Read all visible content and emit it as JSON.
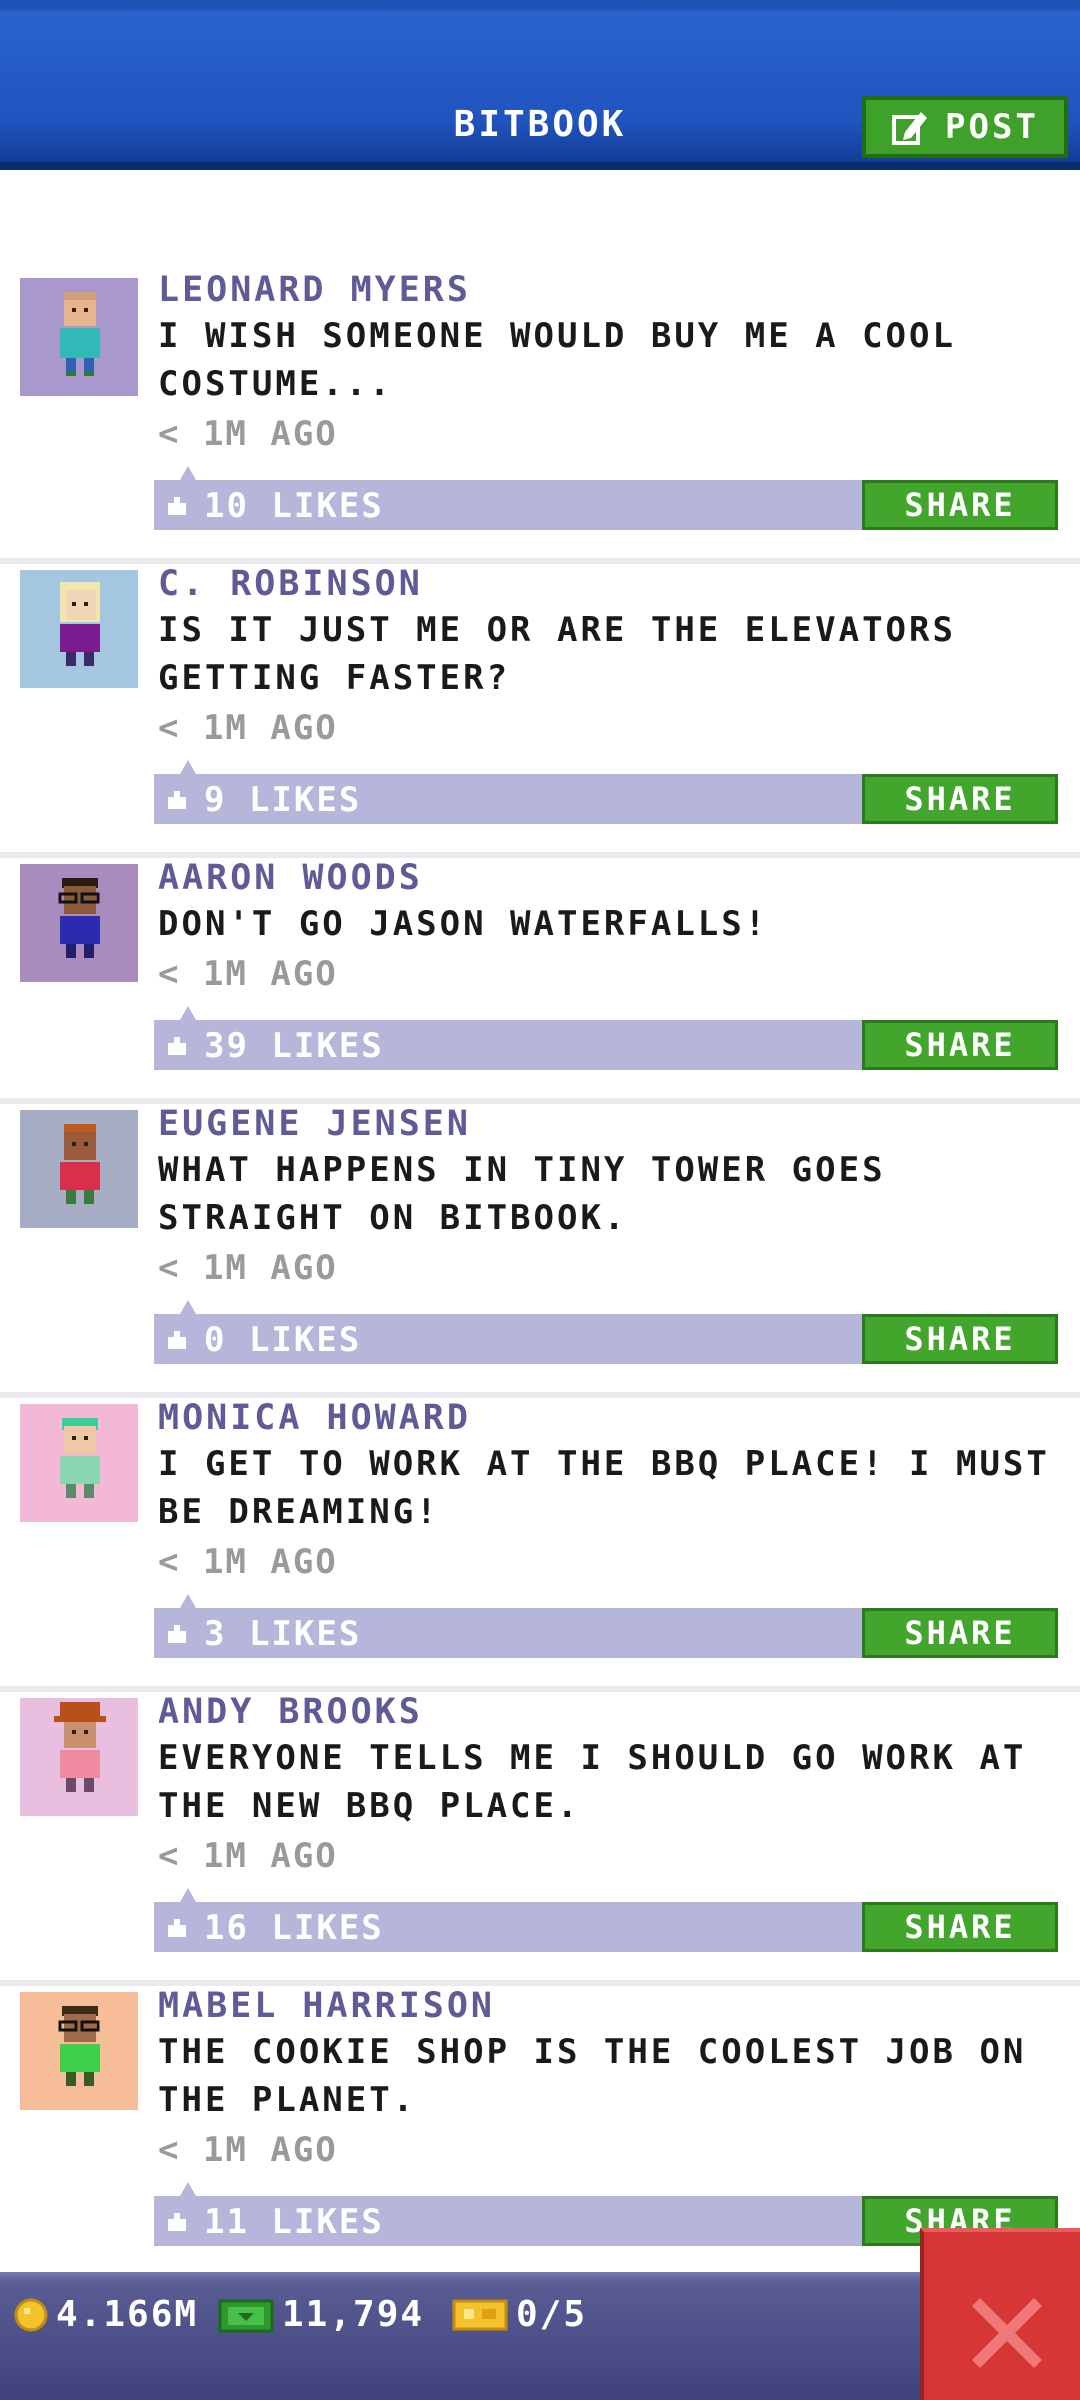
{
  "header": {
    "title": "BITBOOK",
    "post_label": "POST"
  },
  "posts": [
    {
      "name": "LEONARD MYERS",
      "message": "I WISH SOMEONE WOULD BUY ME A COOL COSTUME...",
      "time": "< 1M AGO",
      "likes": "10 LIKES",
      "share": "SHARE",
      "avatar_bg": "#a898cc"
    },
    {
      "name": "C. ROBINSON",
      "message": "IS IT JUST ME OR ARE THE ELEVATORS GETTING FASTER?",
      "time": "< 1M AGO",
      "likes": "9 LIKES",
      "share": "SHARE",
      "avatar_bg": "#a4c6df"
    },
    {
      "name": "AARON WOODS",
      "message": "DON'T GO JASON WATERFALLS!",
      "time": "< 1M AGO",
      "likes": "39 LIKES",
      "share": "SHARE",
      "avatar_bg": "#a98cbe"
    },
    {
      "name": "EUGENE JENSEN",
      "message": "WHAT HAPPENS IN TINY TOWER GOES STRAIGHT ON BITBOOK.",
      "time": "< 1M AGO",
      "likes": "0 LIKES",
      "share": "SHARE",
      "avatar_bg": "#a6adc4"
    },
    {
      "name": "MONICA HOWARD",
      "message": "I GET TO WORK AT THE BBQ PLACE! I MUST BE DREAMING!",
      "time": "< 1M AGO",
      "likes": "3 LIKES",
      "share": "SHARE",
      "avatar_bg": "#f2b8d6"
    },
    {
      "name": "ANDY BROOKS",
      "message": "EVERYONE TELLS ME I SHOULD GO WORK AT THE NEW BBQ PLACE.",
      "time": "< 1M AGO",
      "likes": "16 LIKES",
      "share": "SHARE",
      "avatar_bg": "#e8bfdf"
    },
    {
      "name": "MABEL HARRISON",
      "message": "THE COOKIE SHOP IS THE COOLEST JOB ON THE PLANET.",
      "time": "< 1M AGO",
      "likes": "11 LIKES",
      "share": "SHARE",
      "avatar_bg": "#f7bd98"
    }
  ],
  "bottom": {
    "coins": "4.166M",
    "bux": "11,794",
    "tickets": "0/5"
  },
  "colors": {
    "header_blue": "#2054bf",
    "share_green": "#42a52c",
    "like_bar": "#b5b6da",
    "close_red": "#d63636"
  },
  "icons": [
    "post-edit-icon",
    "like-icon",
    "coin-icon",
    "bux-icon",
    "ticket-icon",
    "close-icon"
  ]
}
